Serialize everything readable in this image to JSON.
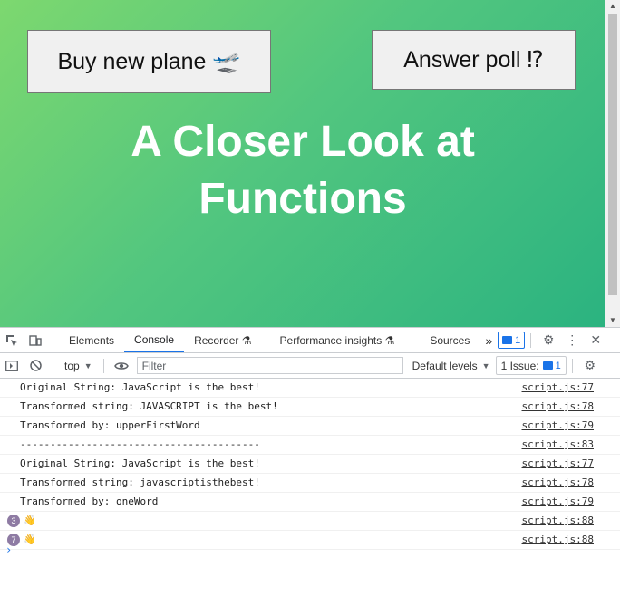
{
  "page": {
    "plane_button": "Buy new plane 🛫",
    "poll_button": "Answer poll ⁉",
    "heading_line1": "A Closer Look at",
    "heading_line2": "Functions"
  },
  "devtools": {
    "tabs": [
      "Elements",
      "Console",
      "Recorder ⚗",
      "Performance insights ⚗",
      "Sources"
    ],
    "more": "»",
    "message_badge": "1",
    "context": "top",
    "filter_placeholder": "Filter",
    "levels": "Default levels",
    "issues_label": "1 Issue:",
    "issues_count": "1"
  },
  "console": {
    "rows": [
      {
        "msg": "Original String: JavaScript is the best!",
        "src": "script.js:77"
      },
      {
        "msg": "Transformed string: JAVASCRIPT is the best!",
        "src": "script.js:78"
      },
      {
        "msg": "Transformed by: upperFirstWord",
        "src": "script.js:79"
      },
      {
        "msg": "----------------------------------------",
        "src": "script.js:83"
      },
      {
        "msg": "Original String: JavaScript is the best!",
        "src": "script.js:77"
      },
      {
        "msg": "Transformed string: javascriptisthebest!",
        "src": "script.js:78"
      },
      {
        "msg": "Transformed by: oneWord",
        "src": "script.js:79"
      }
    ],
    "grouped": [
      {
        "count": "3",
        "msg": "👋",
        "src": "script.js:88"
      },
      {
        "count": "7",
        "msg": "👋",
        "src": "script.js:88"
      }
    ],
    "prompt": "›"
  }
}
